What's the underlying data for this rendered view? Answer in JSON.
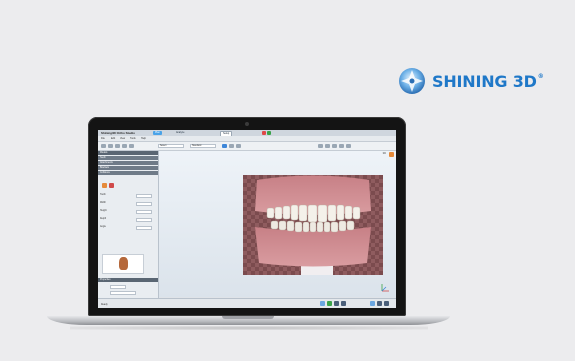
{
  "brand": {
    "name": "SHINING 3D",
    "mark": "®"
  },
  "app": {
    "title": "Shining3D Ortho Studio",
    "tabs": [
      "Plan",
      "Analyze",
      "Setup"
    ],
    "menu": [
      "File",
      "Edit",
      "View",
      "Tools",
      "Help"
    ],
    "toolbar_dropdowns": [
      "Select",
      "Standard"
    ],
    "left_panel": {
      "sections": [
        "Models",
        "Teeth",
        "Attachments",
        "Brackets",
        "Collisions"
      ],
      "fields": [
        "Tooth",
        "Width",
        "Height",
        "Depth",
        "Angle"
      ],
      "footer_section": "Properties"
    },
    "viewport_label": "3D",
    "status_text": "Ready"
  },
  "colors": {
    "brand_blue": "#1f78c8",
    "gum": "#d08a8f",
    "tooth": "#f4f1ea",
    "accent_orange": "#e58a3a"
  }
}
